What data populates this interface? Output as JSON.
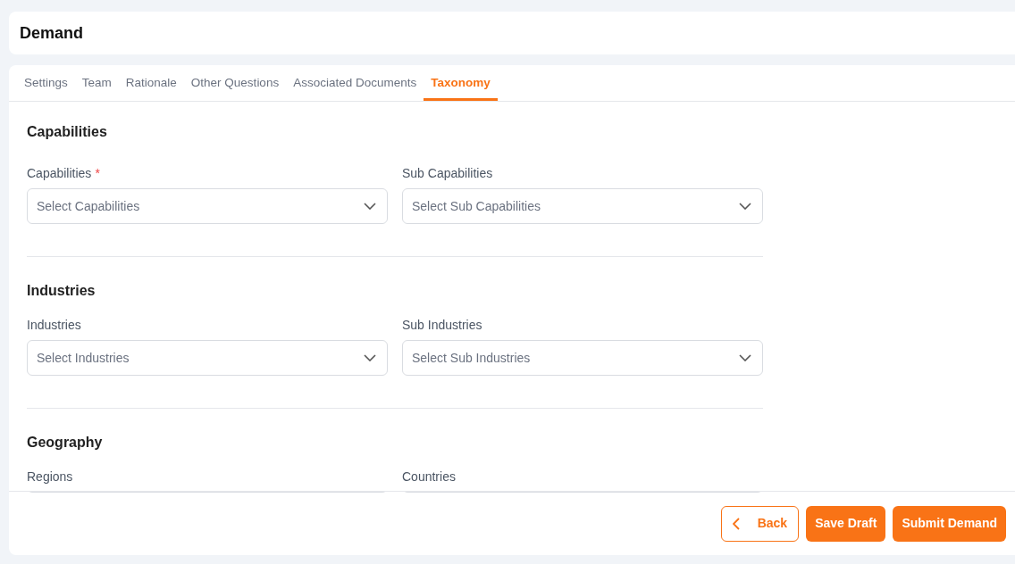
{
  "page": {
    "title": "Demand"
  },
  "tabs": [
    {
      "label": "Settings",
      "selected": false
    },
    {
      "label": "Team",
      "selected": false
    },
    {
      "label": "Rationale",
      "selected": false
    },
    {
      "label": "Other Questions",
      "selected": false
    },
    {
      "label": "Associated Documents",
      "selected": false
    },
    {
      "label": "Taxonomy",
      "selected": true
    }
  ],
  "sections": [
    {
      "title": "Capabilities",
      "fields": [
        {
          "label": "Capabilities",
          "required_mark": "*",
          "placeholder": "Select Capabilities"
        },
        {
          "label": "Sub Capabilities",
          "placeholder": "Select Sub Capabilities"
        }
      ]
    },
    {
      "title": "Industries",
      "fields": [
        {
          "label": "Industries",
          "placeholder": "Select Industries"
        },
        {
          "label": "Sub Industries",
          "placeholder": "Select Sub Industries"
        }
      ]
    },
    {
      "title": "Geography",
      "fields": [
        {
          "label": "Regions"
        },
        {
          "label": "Countries"
        }
      ]
    }
  ],
  "footer": {
    "back": "Back",
    "save": "Save Draft",
    "submit": "Submit Demand"
  }
}
